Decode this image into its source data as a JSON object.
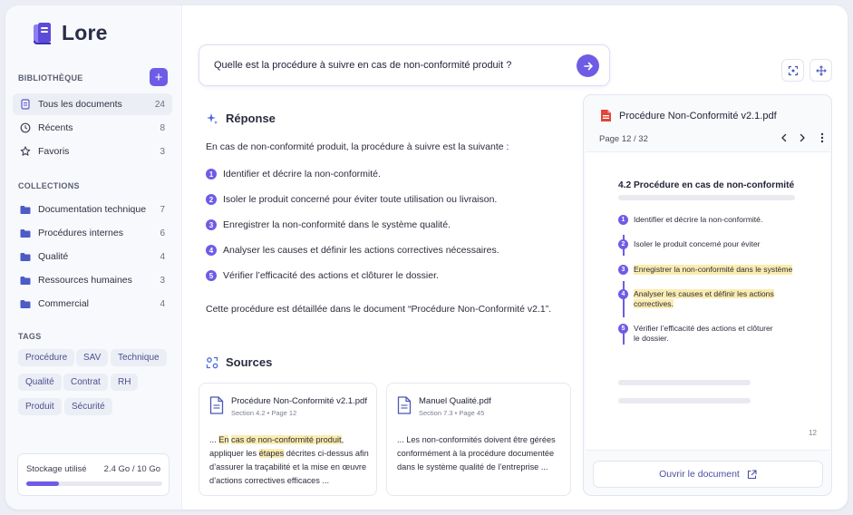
{
  "app": {
    "name": "Lore",
    "accent": "#6e5ce6"
  },
  "sidebar": {
    "library_title": "BIBLIOTHÈQUE",
    "add_label": "+",
    "library_items": [
      {
        "label": "Tous les documents",
        "count": "24",
        "icon": "document-icon",
        "active": true
      },
      {
        "label": "Récents",
        "count": "8",
        "icon": "clock-icon",
        "active": false
      },
      {
        "label": "Favoris",
        "count": "3",
        "icon": "star-icon",
        "active": false
      }
    ],
    "collections_title": "COLLECTIONS",
    "collections": [
      {
        "label": "Documentation technique",
        "count": "7",
        "icon": "folder-icon"
      },
      {
        "label": "Procédures internes",
        "count": "6",
        "icon": "folder-icon"
      },
      {
        "label": "Qualité",
        "count": "4",
        "icon": "folder-icon"
      },
      {
        "label": "Ressources humaines",
        "count": "3",
        "icon": "folder-icon"
      },
      {
        "label": "Commercial",
        "count": "4",
        "icon": "folder-icon"
      }
    ],
    "tags_title": "TAGS",
    "tags": [
      "Procédure",
      "SAV",
      "Technique",
      "Qualité",
      "Contrat",
      "RH",
      "Produit",
      "Sécurité"
    ],
    "storage": {
      "label": "Stockage utilisé",
      "value": "2.4 Go / 10 Go",
      "fraction": 0.24
    }
  },
  "search": {
    "query": "Quelle est la procédure à suivre en cas de non-conformité produit ?",
    "send_icon": "send-arrow-icon"
  },
  "toolbar": {
    "left_icon": "focus-icon",
    "right_icon": "move-icon"
  },
  "answer": {
    "title": "Réponse",
    "title_icon": "sparkle-icon",
    "intro": "En cas de non-conformité produit, la procédure à suivre est la suivante :",
    "steps": [
      {
        "num": "1",
        "text": "Identifier et décrire la non-conformité."
      },
      {
        "num": "2",
        "text": "Isoler le produit concerné pour éviter toute utilisation ou livraison."
      },
      {
        "num": "3",
        "text": "Enregistrer la non-conformité dans le système qualité."
      },
      {
        "num": "4",
        "text": "Analyser les causes et définir les actions correctives nécessaires."
      },
      {
        "num": "5",
        "text": "Vérifier l’efficacité des actions et clôturer le dossier."
      }
    ],
    "outro": "Cette procédure est détaillée dans le document “Procédure Non-Conformité v2.1”."
  },
  "sources": {
    "title": "Sources",
    "title_icon": "sources-icon",
    "cards": [
      {
        "title": "Procédure Non-Conformité v2.1.pdf",
        "meta": "Section 4.2  •  Page 12",
        "excerpt_parts": [
          {
            "t": "... ",
            "hl": false
          },
          {
            "t": "En",
            "hl": true
          },
          {
            "t": " ",
            "hl": false
          },
          {
            "t": "cas de non-conformité produit",
            "hl": true
          },
          {
            "t": ", appliquer les ",
            "hl": false
          },
          {
            "t": "étapes",
            "hl": true
          },
          {
            "t": " décrites ci-dessus afin d’assurer la traçabilité et la mise en œuvre d’actions correctives efficaces ...",
            "hl": false
          }
        ]
      },
      {
        "title": "Manuel Qualité.pdf",
        "meta": "Section 7.3  •  Page 45",
        "excerpt_parts": [
          {
            "t": "... Les non-conformités doivent être gérées conformément à la procédure documentée dans le système qualité de l’entreprise ...",
            "hl": false
          }
        ]
      }
    ]
  },
  "viewer": {
    "file_icon": "pdf-file-icon",
    "title": "Procédure Non-Conformité v2.1.pdf",
    "page_label": "Page 12 / 32",
    "prev_icon": "chevron-left-icon",
    "next_icon": "chevron-right-icon",
    "more_icon": "more-vertical-icon",
    "doc": {
      "heading": "4.2   Procédure en cas de non-conformité",
      "steps": [
        {
          "num": "1",
          "text": "Identifier et décrire la non-conformité.",
          "highlight": false
        },
        {
          "num": "2",
          "text": "Isoler le produit concerné pour éviter",
          "highlight": false
        },
        {
          "num": "3",
          "text": "Enregistrer la non-conformité dans le système",
          "highlight": true
        },
        {
          "num": "4",
          "text": "Analyser les causes et définir les actions correctives.",
          "highlight": true
        },
        {
          "num": "5",
          "text": "Vérifier l’efficacité des actions et clôturer le dossier.",
          "highlight": false
        }
      ],
      "page_number": "12"
    },
    "open_label": "Ouvrir le document",
    "open_icon": "external-link-icon"
  }
}
